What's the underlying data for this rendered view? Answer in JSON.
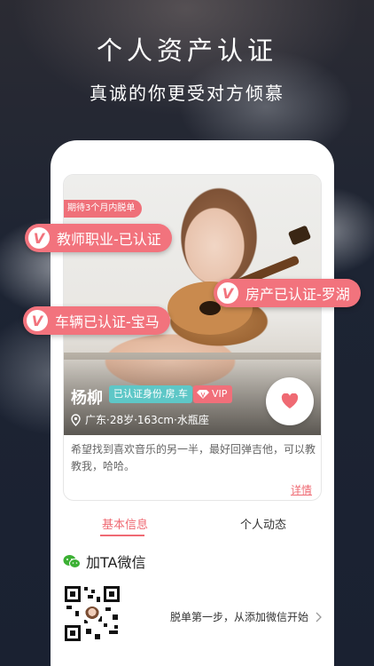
{
  "hero": {
    "title": "个人资产认证",
    "subtitle": "真诚的你更受对方倾慕"
  },
  "profile": {
    "wait_tag": "期待3个月内脱单",
    "name": "杨柳",
    "verified_badge": "已认证身份.房.车",
    "vip_label": "VIP",
    "location": "广东·28岁·163cm·水瓶座",
    "bio": "希望找到喜欢音乐的另一半，最好回弹吉他，可以教教我，哈哈。",
    "detail_link": "详情"
  },
  "badges": [
    {
      "icon": "V",
      "label": "教师职业-已认证"
    },
    {
      "icon": "V",
      "label": "房产已认证-罗湖"
    },
    {
      "icon": "V",
      "label": "车辆已认证-宝马"
    }
  ],
  "tabs": [
    {
      "label": "基本信息"
    },
    {
      "label": "个人动态"
    }
  ],
  "wechat": {
    "label": "加TA微信",
    "cta": "脱单第一步，从添加微信开始"
  },
  "colors": {
    "accent": "#ef6a73",
    "teal": "#5ec7c7",
    "wechat_green": "#3cb034"
  }
}
